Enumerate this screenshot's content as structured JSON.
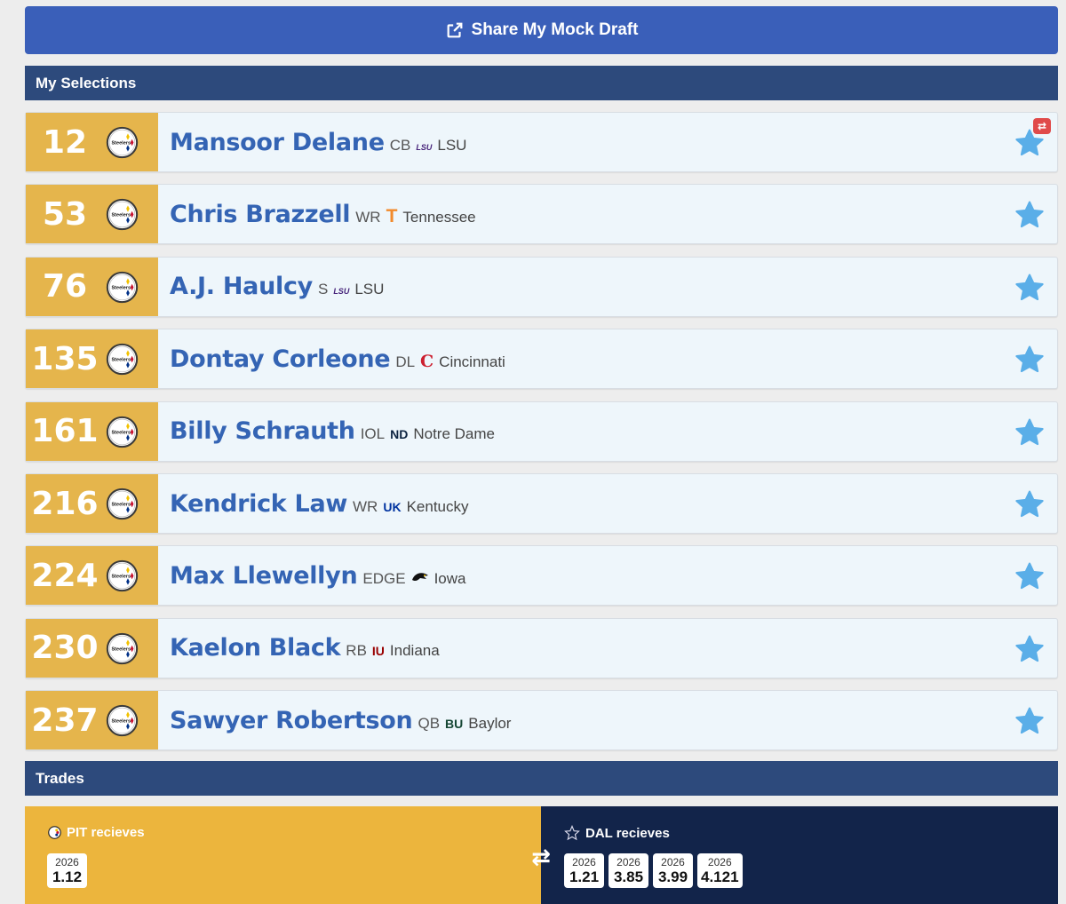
{
  "share": {
    "label": "Share My Mock Draft"
  },
  "sections": {
    "selections": "My Selections",
    "trades": "Trades"
  },
  "picks": [
    {
      "num": "12",
      "name": "Mansoor Delane",
      "pos": "CB",
      "school_logo": "LSU",
      "school": "LSU",
      "logo_color": "#46237a",
      "traded": true
    },
    {
      "num": "53",
      "name": "Chris Brazzell",
      "pos": "WR",
      "school_logo": "T",
      "school": "Tennessee",
      "logo_color": "#f28a2b",
      "traded": false
    },
    {
      "num": "76",
      "name": "A.J. Haulcy",
      "pos": "S",
      "school_logo": "LSU",
      "school": "LSU",
      "logo_color": "#46237a",
      "traded": false
    },
    {
      "num": "135",
      "name": "Dontay Corleone",
      "pos": "DL",
      "school_logo": "C",
      "school": "Cincinnati",
      "logo_color": "#cc1f2f",
      "traded": false
    },
    {
      "num": "161",
      "name": "Billy Schrauth",
      "pos": "IOL",
      "school_logo": "ND",
      "school": "Notre Dame",
      "logo_color": "#0c2340",
      "traded": false
    },
    {
      "num": "216",
      "name": "Kendrick Law",
      "pos": "WR",
      "school_logo": "UK",
      "school": "Kentucky",
      "logo_color": "#0033a0",
      "traded": false
    },
    {
      "num": "224",
      "name": "Max Llewellyn",
      "pos": "EDGE",
      "school_logo": "hawk-icon",
      "school": "Iowa",
      "logo_color": "#111111",
      "traded": false
    },
    {
      "num": "230",
      "name": "Kaelon Black",
      "pos": "RB",
      "school_logo": "IU",
      "school": "Indiana",
      "logo_color": "#990000",
      "traded": false
    },
    {
      "num": "237",
      "name": "Sawyer Robertson",
      "pos": "QB",
      "school_logo": "BU",
      "school": "Baylor",
      "logo_color": "#154734",
      "traded": false
    }
  ],
  "trades": {
    "left": {
      "label": "PIT recieves",
      "picks": [
        {
          "year": "2026",
          "pick": "1.12"
        }
      ]
    },
    "right": {
      "label": "DAL recieves",
      "picks": [
        {
          "year": "2026",
          "pick": "1.21"
        },
        {
          "year": "2026",
          "pick": "3.85"
        },
        {
          "year": "2026",
          "pick": "3.99"
        },
        {
          "year": "2026",
          "pick": "4.121"
        }
      ]
    }
  },
  "colors": {
    "pick_bg": "#e5b54c",
    "name": "#3464b4",
    "star": "#5aaee8",
    "header": "#2d4a7c",
    "share": "#3a5fb9"
  }
}
